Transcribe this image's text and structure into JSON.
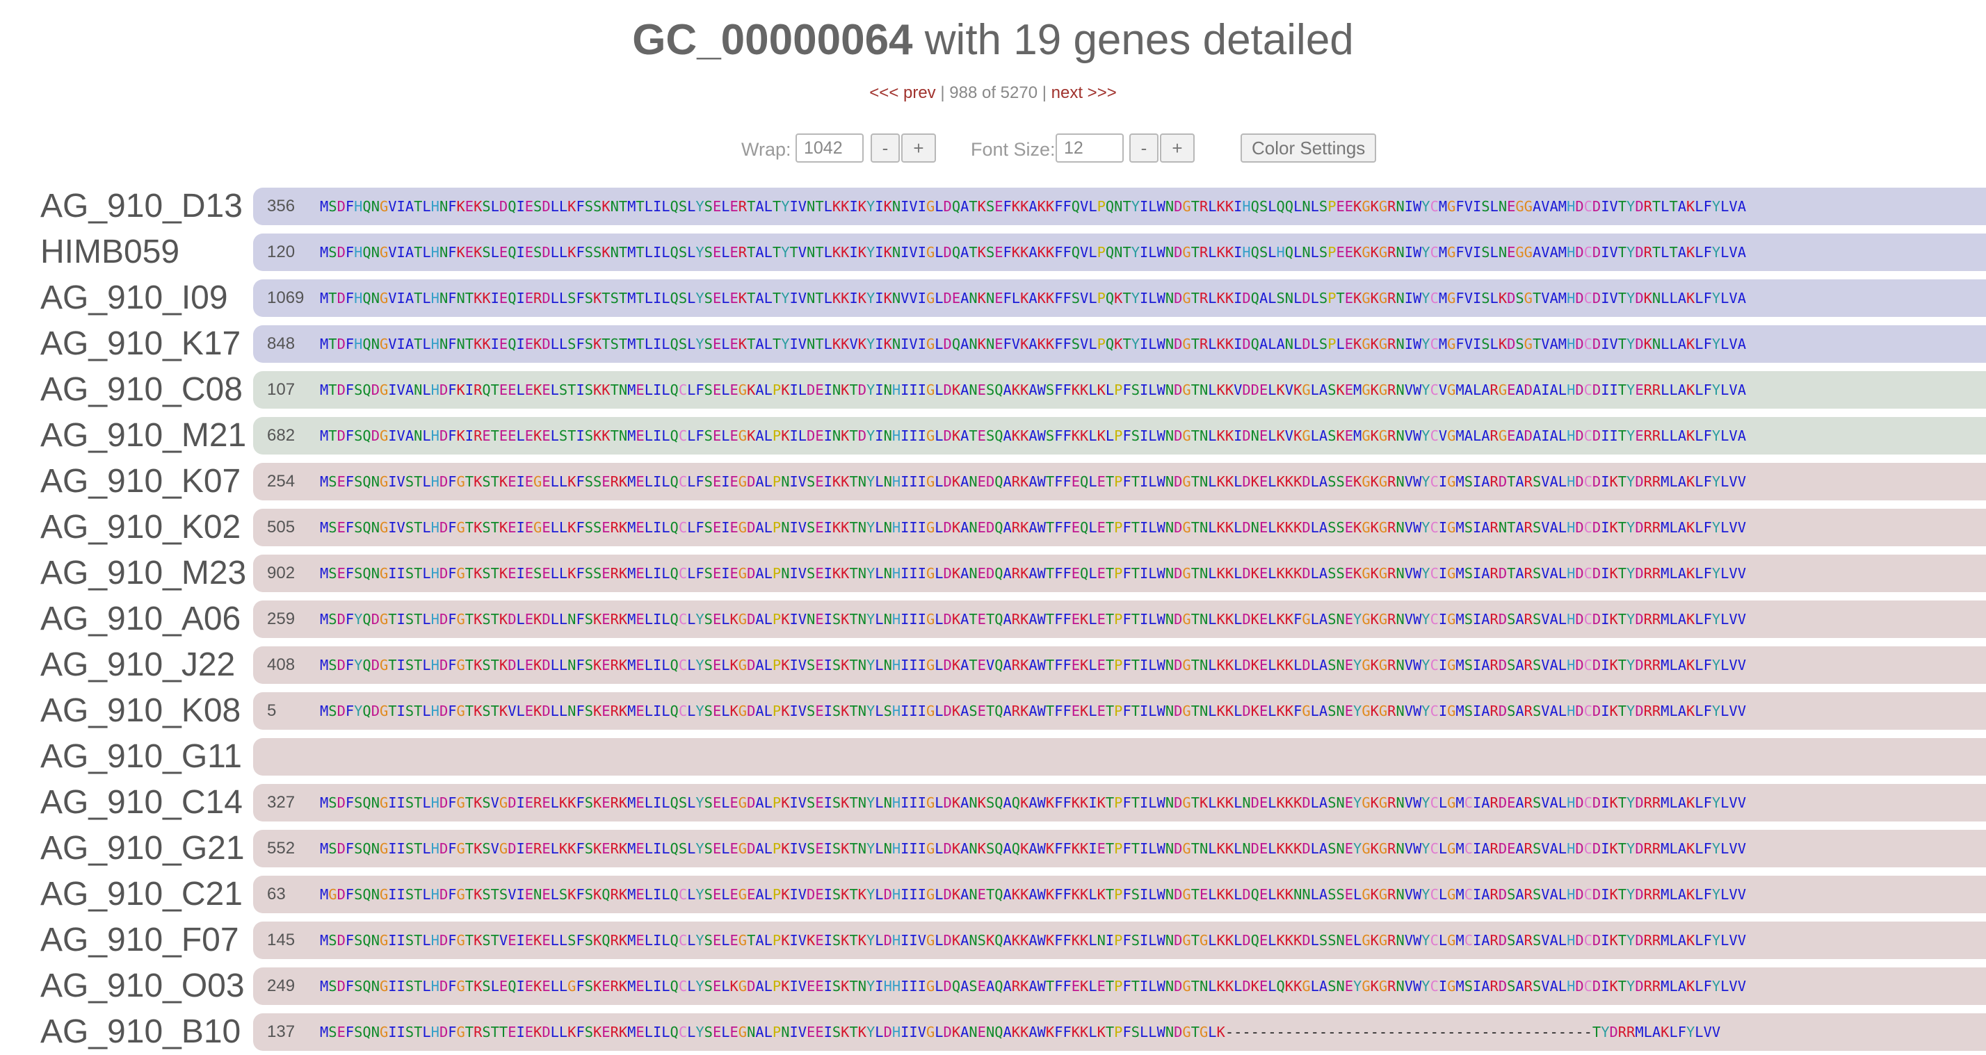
{
  "header": {
    "gc_id": "GC_00000064",
    "subtitle": " with 19 genes detailed"
  },
  "nav": {
    "prev_label": "<<< prev",
    "sep1": " | ",
    "position": "988 of 5270",
    "sep2": " | ",
    "next_label": "next >>>"
  },
  "controls": {
    "wrap_label": "Wrap:",
    "wrap_value": "1042",
    "font_size_label": "Font Size:",
    "font_size_value": "12",
    "minus": "-",
    "plus": "+",
    "color_settings": "Color Settings"
  },
  "aa_colors": {
    "hydrophobic": "#1a1ad6",
    "positive": "#d6152b",
    "negative": "#c0158f",
    "polar": "#0f8a2a",
    "glycine": "#e08a1e",
    "proline": "#c8b400",
    "aromatic": "#2b9ea0",
    "histidine": "#36a0c8",
    "cysteine": "#e07ad0",
    "gap": "#222222"
  },
  "bar_colors": {
    "group1": "#cfd0e6",
    "group2": "#d8e0d8",
    "group3": "#e2d4d4"
  },
  "genes": [
    {
      "name": "AG_910_D13",
      "length": "356",
      "group": "group1",
      "seq": "MSDFHQNGVIATLHNFKEKSLDQIESDLLKFSSKNTMTLILQSLYSELERTALTYIVNTLKKIKYIKNIVIGLDQATKSEFKKAKKFFQVLPQNTYILWNDGTRLKKIHQSLQQLNLSPEEKGKGRNIWYCMGFVISLNEGGAVAMHDCDIVTYDRTLTAKLFYLVA"
    },
    {
      "name": "HIMB059",
      "length": "120",
      "group": "group1",
      "seq": "MSDFHQNGVIATLHNFKEKSLEQIESDLLKFSSKNTMTLILQSLYSELERTALTYTVNTLKKIKYIKNIVIGLDQATKSEFKKAKKFFQVLPQNTYILWNDGTRLKKIHQSLHQLNLSPEEKGKGRNIWYCMGFVISLNEGGAVAMHDCDIVTYDRTLTAKLFYLVA"
    },
    {
      "name": "AG_910_I09",
      "length": "1069",
      "group": "group1",
      "seq": "MTDFHQNGVIATLHNFNTKKIEQIERDLLSFSKTSTMTLILQSLYSELEKTALTYIVNTLKKIKYIKNVVIGLDEANKNEFLKAKKFFSVLPQKTYILWNDGTRLKKIDQALSNLDLSPTEKGKGRNIWYCMGFVISLKDSGTVAMHDCDIVTYDKNLLAKLFYLVA"
    },
    {
      "name": "AG_910_K17",
      "length": "848",
      "group": "group1",
      "seq": "MTDFHQNGVIATLHNFNTKKIEQIEKDLLSFSKTSTMTLILQSLYSELEKTALTYIVNTLKKVKYIKNIVIGLDQANKNEFVKAKKFFSVLPQKTYILWNDGTRLKKIDQALANLDLSPLEKGKGRNIWYCMGFVISLKDSGTVAMHDCDIVTYDKNLLAKLFYLVA"
    },
    {
      "name": "AG_910_C08",
      "length": "107",
      "group": "group2",
      "seq": "MTDFSQDGIVANLHDFKIRQTEELEKELSTISKKTNMELILQCLFSELEGKALPKILDEINKTDYINHIIIGLDKANESQAKKAWSFFKKLKLPFSILWNDGTNLKKVDDELKVKGLASKEMGKGRNVWYCVGMALARGEADAIALHDCDIITYERRLLAKLFYLVA"
    },
    {
      "name": "AG_910_M21",
      "length": "682",
      "group": "group2",
      "seq": "MTDFSQDGIVANLHDFKIRETEELEKELSTISKKTNMELILQCLFSELEGKALPKILDEINKTDYINHIIIGLDKATESQAKKAWSFFKKLKLPFSILWNDGTNLKKIDNELKVKGLASKEMGKGRNVWYCVGMALARGEADAIALHDCDIITYERRLLAKLFYLVA"
    },
    {
      "name": "AG_910_K07",
      "length": "254",
      "group": "group3",
      "seq": "MSEFSQNGIVSTLHDFGTKSTKEIEGELLKFSSERKMELILQCLFSEIEGDALPNIVSEIKKTNYLNHIIIGLDKANEDQARKAWTFFEQLETPFTILWNDGTNLKKLDKELKKKDLASSEKGKGRNVWYCIGMSIARDTARSVALHDCDIKTYDRRMLAKLFYLVV"
    },
    {
      "name": "AG_910_K02",
      "length": "505",
      "group": "group3",
      "seq": "MSEFSQNGIVSTLHDFGTKSTKEIEGELLKFSSERKMELILQCLFSEIEGDALPNIVSEIKKTNYLNHIIIGLDKANEDQARKAWTFFEQLETPFTILWNDGTNLKKLDNELKKKDLASSEKGKGRNVWYCIGMSIARNTARSVALHDCDIKTYDRRMLAKLFYLVV"
    },
    {
      "name": "AG_910_M23",
      "length": "902",
      "group": "group3",
      "seq": "MSEFSQNGIISTLHDFGTKSTKEIESELLKFSSERKMELILQCLFSEIEGDALPNIVSEIKKTNYLNHIIIGLDKANEDQARKAWTFFEQLETPFTILWNDGTNLKKLDKELKKKDLASSEKGKGRNVWYCIGMSIARDTARSVALHDCDIKTYDRRMLAKLFYLVV"
    },
    {
      "name": "AG_910_A06",
      "length": "259",
      "group": "group3",
      "seq": "MSDFYQDGTISTLHDFGTKSTKDLEKDLLNFSKERKMELILQCLYSELKGDALPKIVNEISKTNYLNHIIIGLDKATETQARKAWTFFEKLETPFTILWNDGTNLKKLDKELKKFGLASNEYGKGRNVWYCIGMSIARDSARSVALHDCDIKTYDRRMLAKLFYLVV"
    },
    {
      "name": "AG_910_J22",
      "length": "408",
      "group": "group3",
      "seq": "MSDFYQDGTISTLHDFGTKSTKDLEKDLLNFSKERKMELILQCLYSELKGDALPKIVSEISKTNYLNHIIIGLDKATEVQARKAWTFFEKLETPFTILWNDGTNLKKLDKELKKLDLASNEYGKGRNVWYCIGMSIARDSARSVALHDCDIKTYDRRMLAKLFYLVV"
    },
    {
      "name": "AG_910_K08",
      "length": "5",
      "group": "group3",
      "seq": "MSDFYQDGTISTLHDFGTKSTKVLEKDLLNFSKERKMELILQCLYSELKGDALPKIVSEISKTNYLSHIIIGLDKASETQARKAWTFFEKLETPFTILWNDGTNLKKLDKELKKFGLASNEYGKGRNVWYCIGMSIARDSARSVALHDCDIKTYDRRMLAKLFYLVV"
    },
    {
      "name": "AG_910_G11",
      "length": "",
      "group": "group3",
      "seq": ""
    },
    {
      "name": "AG_910_C14",
      "length": "327",
      "group": "group3",
      "seq": "MSDFSQNGIISTLHDFGTKSVGDIERELKKFSKERKMELILQSLYSELEGDALPKIVSEISKTNYLNHIIIGLDKANKSQAQKAWKFFKKIKTPFTILWNDGTKLKKLNDELKKKDLASNEYGKGRNVWYCLGMCIARDEARSVALHDCDIKTYDRRMLAKLFYLVV"
    },
    {
      "name": "AG_910_G21",
      "length": "552",
      "group": "group3",
      "seq": "MSDFSQNGIISTLHDFGTKSVGDIERELKKFSKERKMELILQSLYSELEGDALPKIVSEISKTNYLNHIIIGLDKANKSQAQKAWKFFKKIETPFTILWNDGTNLKKLNDELKKKDLASNEYGKGRNVWYCLGMCIARDEARSVALHDCDIKTYDRRMLAKLFYLVV"
    },
    {
      "name": "AG_910_C21",
      "length": "63",
      "group": "group3",
      "seq": "MGDFSQNGIISTLHDFGTKSTSVIENELSKFSKQRKMELILQCLYSELEGEALPKIVDEISKTKYLDHIIIGLDKANETQAKKAWKFFKKLKTPFSILWNDGTELKKLDQELKKNNLASSELGKGRNVWYCLGMCIARDSARSVALHDCDIKTYDRRMLAKLFYLVV"
    },
    {
      "name": "AG_910_F07",
      "length": "145",
      "group": "group3",
      "seq": "MSDFSQNGIISTLHDFGTKSTVEIEKELLSFSKQRKMELILQCLYSELEGTALPKIVKEISKTKYLDHIIVGLDKANSKQAKKAWKFFKKLNIPFSILWNDGTGLKKLDQELKKKDLSSNELGKGRNVWYCLGMCIARDSARSVALHDCDIKTYDRRMLAKLFYLVV"
    },
    {
      "name": "AG_910_O03",
      "length": "249",
      "group": "group3",
      "seq": "MSDFSQNGIISTLHDFGTKSLEQIEKELLGFSKERKMELILQCLYSELKGDALPKIVEEISKTNYIHHIIIGLDQASEAQARKAWTFFEKLETPFTILWNDGTNLKKLDKELQKKGLASNEYGKGRNVWYCIGMSIARDSARSVALHDCDIKTYDRRMLAKLFYLVV"
    },
    {
      "name": "AG_910_B10",
      "length": "137",
      "group": "group3",
      "seq": "MSEFSQNGIISTLHDFGTRSTTEIEKDLLKFSKERKMELILQCLYSELEGNALPNIVEEISKTKYLDHIIVGLDKANENQAKKAWKFFKKLKTPFSLLWNDGTGLK-------------------------------------------TYDRRMLAKLFYLVV"
    }
  ]
}
